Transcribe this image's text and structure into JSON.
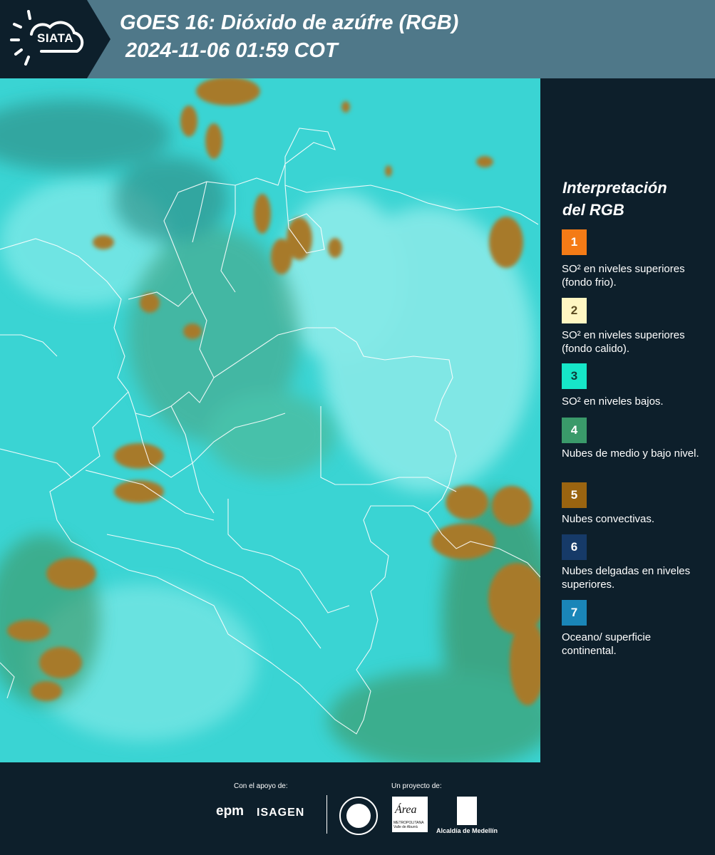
{
  "header": {
    "logo_text": "SIATA",
    "title_line1": "GOES 16: Dióxido de azúfre (RGB)",
    "title_line2": "2024-11-06 01:59 COT"
  },
  "legend": {
    "title_line1": "Interpretación",
    "title_line2": "del RGB",
    "items": [
      {
        "number": "1",
        "color": "#f47b16",
        "text_color": "#ffffff",
        "label": "SO² en niveles superiores (fondo frio)."
      },
      {
        "number": "2",
        "color": "#fff6c2",
        "text_color": "#5a4a20",
        "label": "SO² en niveles superiores (fondo calido)."
      },
      {
        "number": "3",
        "color": "#16e6c8",
        "text_color": "#0d3b3a",
        "label": "SO² en niveles bajos."
      },
      {
        "number": "4",
        "color": "#3a9a6a",
        "text_color": "#ffffff",
        "label": "Nubes de medio y bajo nivel."
      },
      {
        "number": "5",
        "color": "#9a6410",
        "text_color": "#ffffff",
        "label": "Nubes convectivas."
      },
      {
        "number": "6",
        "color": "#163a68",
        "text_color": "#ffffff",
        "label": "Nubes delgadas en niveles superiores."
      },
      {
        "number": "7",
        "color": "#1a86b8",
        "text_color": "#ffffff",
        "label": "Oceano/ superficie continental."
      }
    ]
  },
  "footer": {
    "support_label": "Con el apoyo de:",
    "project_label": "Un proyecto de:",
    "sponsor1": "epm",
    "sponsor2": "ISAGEN",
    "partner1": "Área",
    "partner1_sub": "METROPOLITANA Valle de Aburrá",
    "partner2": "Alcaldía de Medellín"
  }
}
